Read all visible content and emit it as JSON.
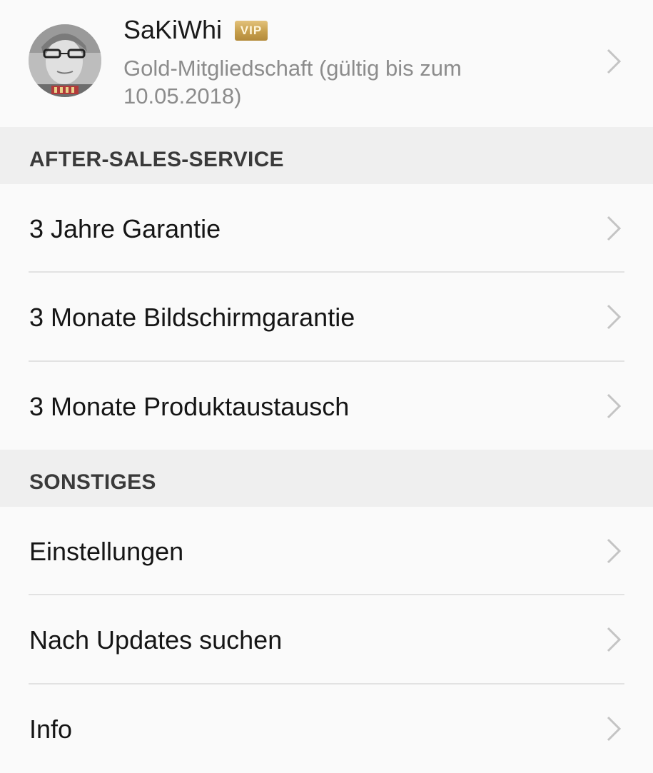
{
  "profile": {
    "username": "SaKiWhi",
    "badge": "VIP",
    "membership": "Gold-Mitgliedschaft (gültig bis zum 10.05.2018)"
  },
  "sections": [
    {
      "title": "AFTER-SALES-SERVICE",
      "items": [
        {
          "label": "3 Jahre Garantie"
        },
        {
          "label": "3 Monate Bildschirmgarantie"
        },
        {
          "label": "3 Monate Produktaustausch"
        }
      ]
    },
    {
      "title": "SONSTIGES",
      "items": [
        {
          "label": "Einstellungen"
        },
        {
          "label": "Nach Updates suchen"
        },
        {
          "label": "Info"
        }
      ]
    }
  ],
  "icons": {
    "row_arrow": "chevron-right-icon",
    "avatar": "avatar"
  },
  "colors": {
    "background": "#fafafa",
    "section_background": "#efefef",
    "badge_gold": "#c9a14e",
    "secondary_text": "#8c8c8c",
    "chevron": "#c4c4c4"
  }
}
